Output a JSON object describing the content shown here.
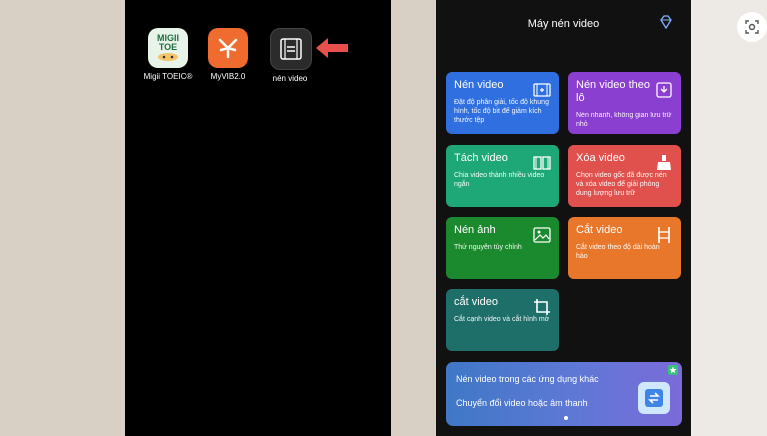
{
  "home": {
    "apps": [
      {
        "label": "Migii TOEIC®",
        "logo_top": "MIGII",
        "logo_mid": "TOE"
      },
      {
        "label": "MyVIB2.0"
      },
      {
        "label": "nén video"
      }
    ]
  },
  "app": {
    "title": "Máy nén video",
    "cards": [
      {
        "title": "Nén video",
        "desc": "Đặt độ phân giải, tốc độ khung hình, tốc độ bit để giảm kích thước tệp",
        "color": "#2f6fe0"
      },
      {
        "title": "Nén video theo lô",
        "desc": "Nén nhanh, không gian lưu trữ nhỏ",
        "color": "#8b3fd1"
      },
      {
        "title": "Tách video",
        "desc": "Chia video thành nhiều video ngắn",
        "color": "#1ea877"
      },
      {
        "title": "Xóa video",
        "desc": "Chọn video gốc đã được nén và xóa video để giải phóng dung lượng lưu trữ",
        "color": "#e0504c"
      },
      {
        "title": "Nén ảnh",
        "desc": "Thứ nguyên tùy chỉnh",
        "color": "#1b8a2e"
      },
      {
        "title": "Cắt video",
        "desc": "Cắt video theo độ dài hoàn hảo",
        "color": "#e9772b"
      },
      {
        "title": "cắt video",
        "desc": "Cắt cạnh video và cắt hình mờ",
        "color": "#1e6f6a"
      }
    ],
    "banner": {
      "title": "Nén video trong các ứng dụng khác",
      "subtitle": "Chuyển đổi video hoặc âm thanh"
    }
  }
}
